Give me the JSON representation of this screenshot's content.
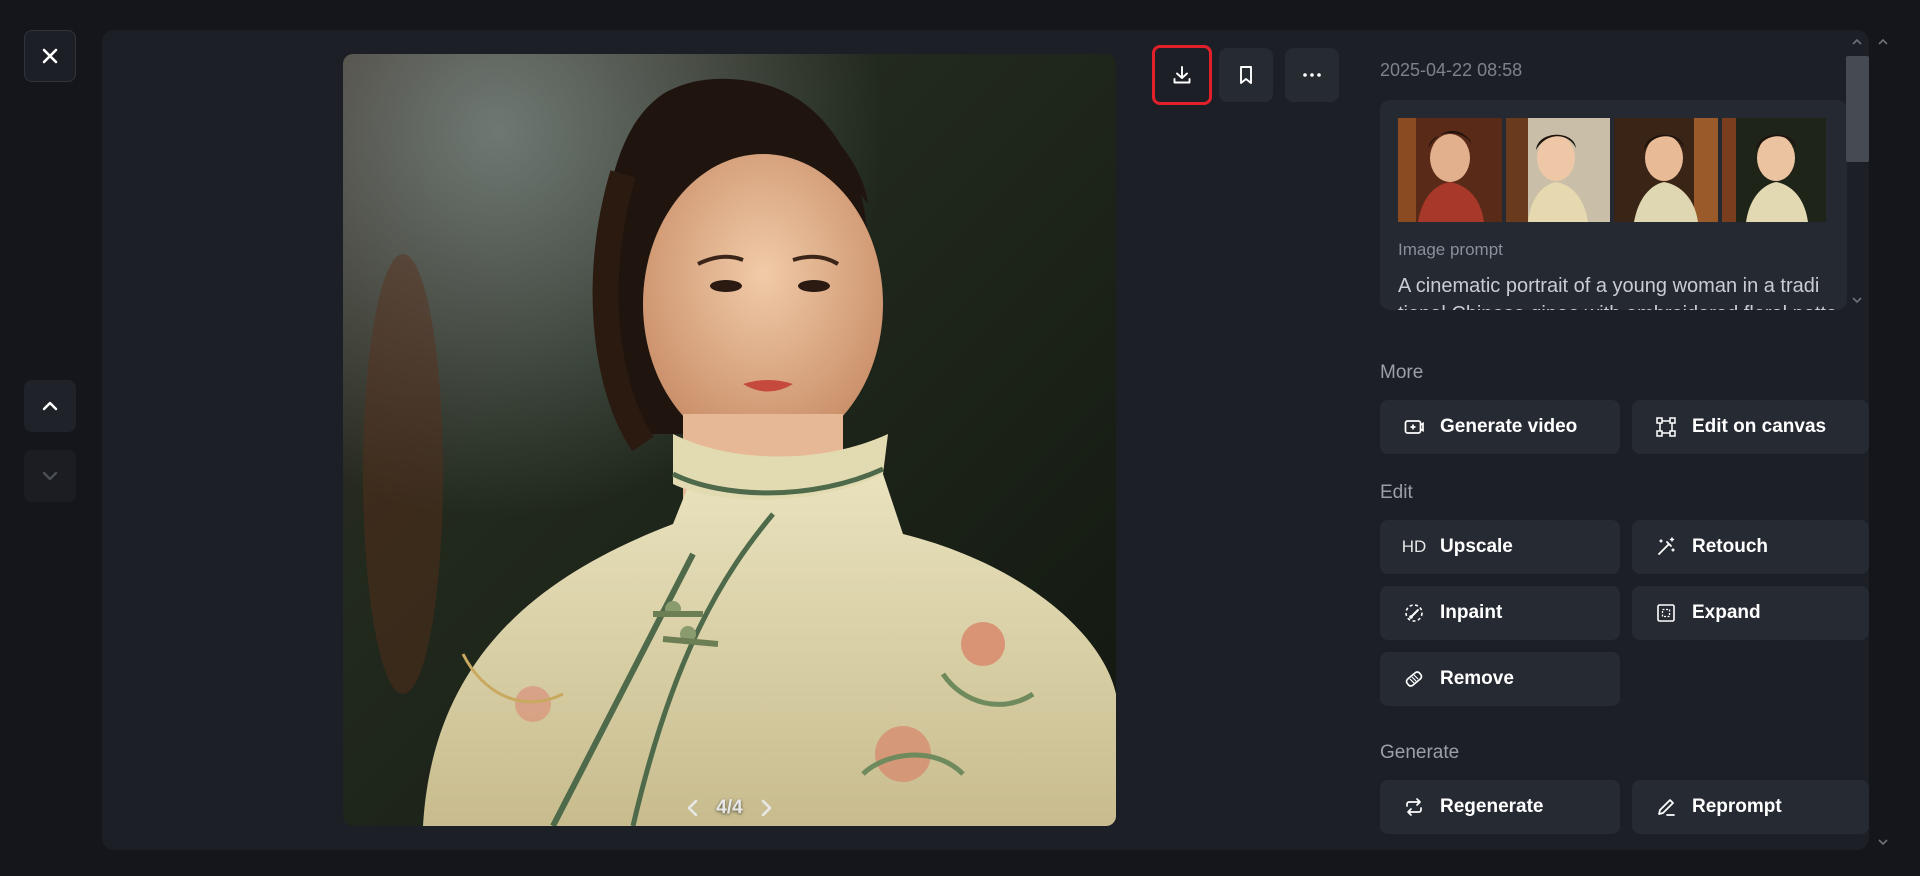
{
  "viewer": {
    "pager": {
      "current": "4/4"
    }
  },
  "toolbar": {
    "download_icon": "download-icon",
    "bookmark_icon": "bookmark-icon",
    "more_icon": "more-dots-icon"
  },
  "side": {
    "timestamp": "2025-04-22 08:58",
    "prompt_label": "Image prompt",
    "prompt_text": "A cinematic portrait of a young woman in a tradi",
    "prompt_text_cont": "tional Chinese qipao with embroidered floral patterns"
  },
  "sections": {
    "more": {
      "title": "More",
      "generate_video": "Generate video",
      "edit_on_canvas": "Edit on canvas"
    },
    "edit": {
      "title": "Edit",
      "upscale_icon_text": "HD",
      "upscale": "Upscale",
      "retouch": "Retouch",
      "inpaint": "Inpaint",
      "expand": "Expand",
      "remove": "Remove"
    },
    "generate": {
      "title": "Generate",
      "regenerate": "Regenerate",
      "reprompt": "Reprompt"
    }
  },
  "colors": {
    "background": "#14161b",
    "panel": "#1c1f26",
    "button": "#262a32",
    "highlight": "#e0202a"
  }
}
